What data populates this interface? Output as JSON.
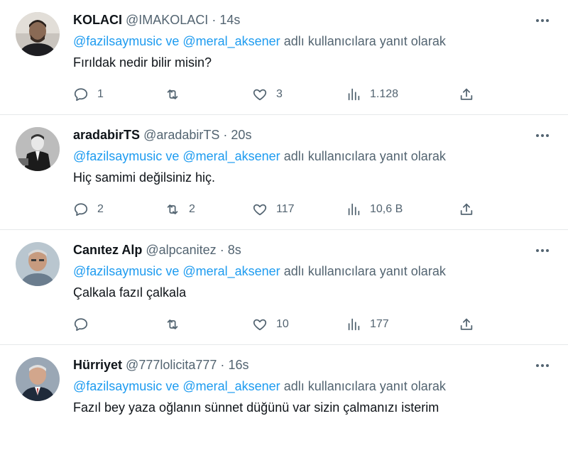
{
  "reply_prefix_joiner": "ve",
  "reply_suffix": "adlı kullanıcılara yanıt olarak",
  "icons": {
    "reply": "speech-bubble-icon",
    "retweet": "retweet-arrows-icon",
    "like": "heart-icon",
    "views": "bar-chart-icon",
    "share": "share-upload-icon",
    "more": "ellipsis-icon"
  },
  "colors": {
    "mention": "#1d9bf0",
    "secondary": "#536471",
    "text": "#0f1419",
    "divider": "#e6e9eb"
  },
  "tweets": [
    {
      "name": "KOLACI",
      "handle": "@IMAKOLACI",
      "time": "14s",
      "mention1": "@fazilsaymusic",
      "mention2": "@meral_aksener",
      "text": "Fırıldak nedir bilir misin?",
      "replies": "1",
      "retweets": "",
      "likes": "3",
      "views": "1.128"
    },
    {
      "name": "aradabirTS",
      "handle": "@aradabirTS",
      "time": "20s",
      "mention1": "@fazilsaymusic",
      "mention2": "@meral_aksener",
      "text": "Hiç samimi değilsiniz hiç.",
      "replies": "2",
      "retweets": "2",
      "likes": "117",
      "views": "10,6 B"
    },
    {
      "name": "Canıtez Alp",
      "handle": "@alpcanitez",
      "time": "8s",
      "mention1": "@fazilsaymusic",
      "mention2": "@meral_aksener",
      "text": "Çalkala fazıl çalkala",
      "replies": "",
      "retweets": "",
      "likes": "10",
      "views": "177"
    },
    {
      "name": "Hürriyet",
      "handle": "@777lolicita777",
      "time": "16s",
      "mention1": "@fazilsaymusic",
      "mention2": "@meral_aksener",
      "text": "Fazıl bey yaza oğlanın sünnet düğünü var sizin çalmanızı isterim",
      "replies": "",
      "retweets": "",
      "likes": "",
      "views": ""
    }
  ]
}
